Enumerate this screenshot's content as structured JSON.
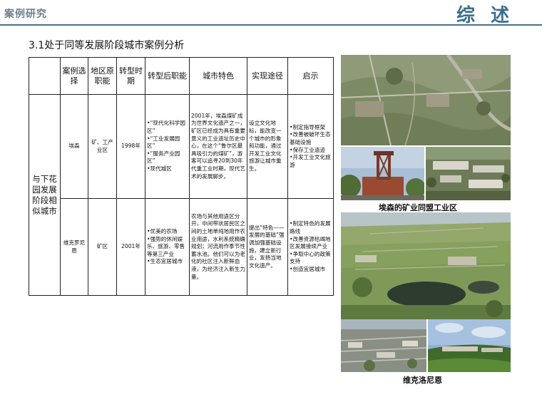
{
  "header": {
    "section_tag": "案例研究",
    "slide_title": "综述"
  },
  "subtitle": "3.1处于同等发展阶段城市案例分析",
  "table": {
    "headers": [
      "",
      "案例选择",
      "地区原职能",
      "转型时期",
      "转型后职能",
      "城市特色",
      "实现途径",
      "启示"
    ],
    "group_label": "与下花园发展阶段相似城市",
    "rows": [
      {
        "case": "埃森",
        "original_function": "矿、工产业区",
        "period": "1998年",
        "new_function": "•“现代化科学园区”\n•“工业发展园区”\n•“服务产业园区”\n•现代城区",
        "features": "2001年，埃森煤矿成为世界文化遗产之一，矿区已经成为具有重要意义的工业遗址历史中心，在这个“鲁尔区最具吸引力的煤矿”，游客可以追寻20到30年代重工业时期，现代艺术的发展脚步。",
        "path": "设立文化地标，能改变一个城市的形象和功能，通过开发工业文化旅游让城市重生。",
        "insight": "•制定指导框架\n•改善被破坏生态基础设施\n•保存工业遗迹\n•开发工业文化旅游"
      },
      {
        "case": "维克罗尼恩",
        "original_function": "矿区",
        "period": "2001年",
        "new_function": "•优美的农场\n•强势的休闲娱乐、旅游、零售等第三产业\n•生态宜居城市",
        "features": "农场与其他用途区分开，中间带状居民区之间的土地单纯地用作农业用途，水利系统精确规划；河流用作季节性蓄水池。他们可以为老化的社区注入新鲜血液，为经济注入新生力量。",
        "path": "提出“特色——发展的基础”强调加强基础设施，建立新行业，发扬当地文化遗产。",
        "insight": "•制定特色的发展路线\n•改善资源枯竭地区发展接续产业\n•争取中心的政策支持\n•创造宜居城市"
      }
    ]
  },
  "captions": {
    "essen": "埃森的矿业同盟工业区",
    "wicklow": "维克洛尼恩"
  },
  "icons": [
    "essen-aerial-photo",
    "zollverein-tower-photo",
    "campus-photo",
    "wicklow-aerial-photo",
    "village-photo"
  ],
  "colors": {
    "title_blue": "#3d6e8f",
    "rule": "#4b6f8c",
    "tag_gray": "#6b7f8c"
  }
}
